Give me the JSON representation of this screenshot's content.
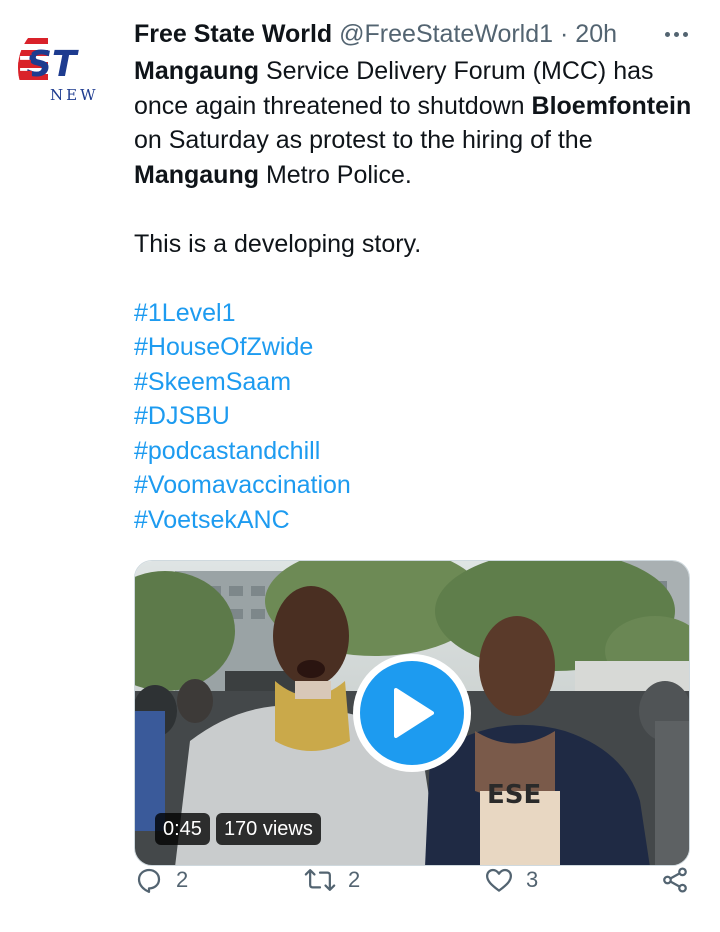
{
  "tweet": {
    "display_name": "Free State World",
    "handle": "@FreeStateWorld1",
    "separator": "·",
    "time": "20h",
    "avatar_logo_text": [
      "E ST",
      "NEW"
    ],
    "text": {
      "seg1_bold": "Mangaung",
      "seg2": " Service Delivery Forum (MCC) has once again threatened to shutdown ",
      "seg3_bold": "Bloemfontein",
      "seg4": " on Saturday as protest to the hiring of the ",
      "seg5_bold": "Mangaung",
      "seg6": "  Metro Police.",
      "line2": "This is a developing story."
    },
    "hashtags": [
      "#1Level1",
      "#HouseOfZwide",
      "#SkeemSaam",
      "#DJSBU",
      "#podcastandchill",
      "#Voomavaccination",
      "#VoetsekANC"
    ],
    "video": {
      "duration": "0:45",
      "views": "170 views",
      "shirt_text": "ESE"
    },
    "actions": {
      "replies": "2",
      "retweets": "2",
      "likes": "3"
    },
    "colors": {
      "accent": "#1d9bf0",
      "text": "#0f1419",
      "muted": "#536471"
    },
    "icons": [
      "more-icon",
      "reply-icon",
      "retweet-icon",
      "like-icon",
      "share-icon",
      "play-icon"
    ]
  }
}
